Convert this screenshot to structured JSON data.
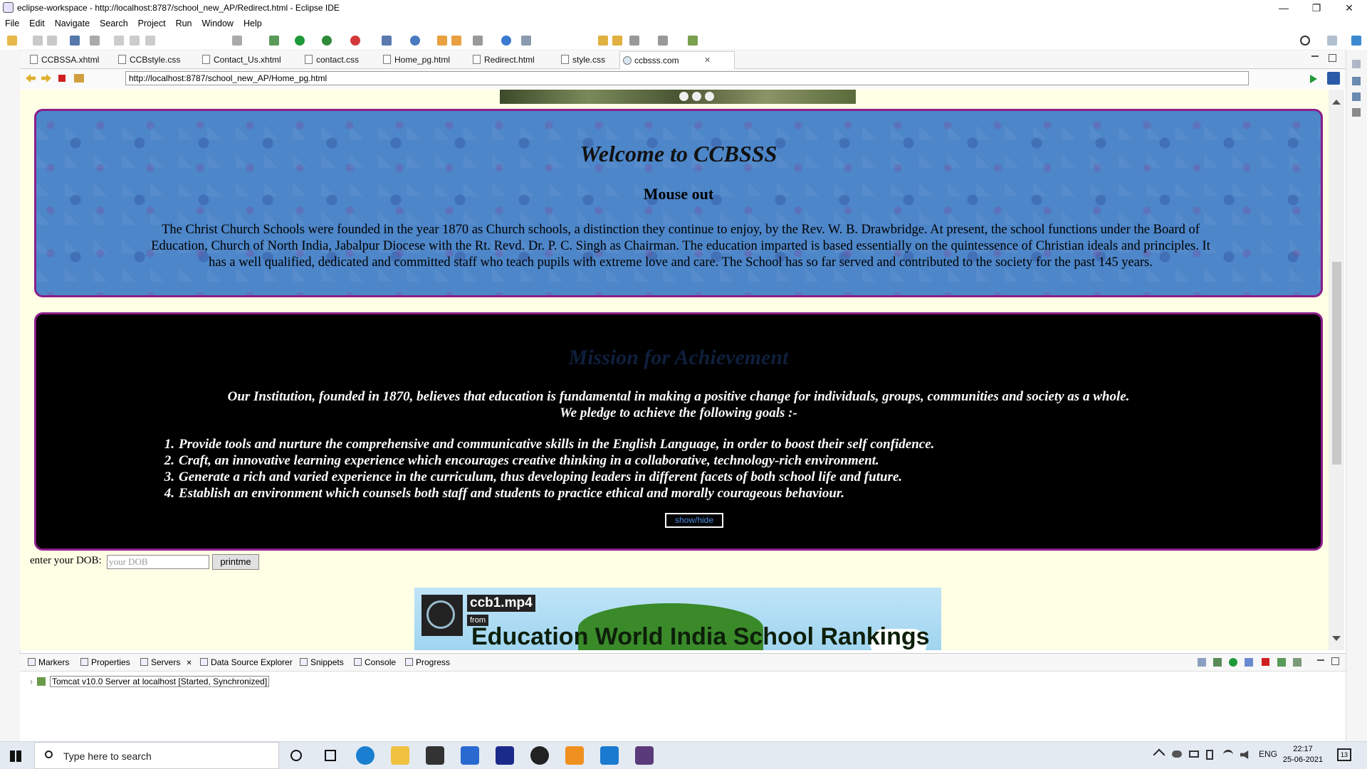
{
  "window": {
    "title": "eclipse-workspace - http://localhost:8787/school_new_AP/Redirect.html - Eclipse IDE",
    "minimize": "—",
    "maximize": "❐",
    "close": "✕"
  },
  "menu": [
    "File",
    "Edit",
    "Navigate",
    "Search",
    "Project",
    "Run",
    "Window",
    "Help"
  ],
  "editor_tabs": [
    {
      "label": "CCBSSA.xhtml"
    },
    {
      "label": "CCBstyle.css"
    },
    {
      "label": "Contact_Us.xhtml"
    },
    {
      "label": "contact.css"
    },
    {
      "label": "Home_pg.html"
    },
    {
      "label": "Redirect.html"
    },
    {
      "label": "style.css"
    },
    {
      "label": "ccbsss.com",
      "active": true
    }
  ],
  "close_icon": "✕",
  "browser": {
    "url": "http://localhost:8787/school_new_AP/Home_pg.html"
  },
  "page": {
    "welcome": {
      "title": "Welcome to CCBSSS",
      "subtitle": "Mouse out",
      "body": "The Christ Church Schools were founded in the year 1870 as Church schools, a distinction they continue to enjoy, by the Rev. W. B. Drawbridge. At present, the school functions under the Board of Education, Church of North India, Jabalpur Diocese with the Rt. Revd. Dr. P. C. Singh as Chairman. The education imparted is based essentially on the quintessence of Christian ideals and principles. It has a well qualified, dedicated and committed staff who teach pupils with extreme love and care. The School has so far served and contributed to the society for the past 145 years."
    },
    "mission": {
      "title": "Mission for Achievement",
      "intro_line1": "Our Institution, founded in 1870, believes that education is fundamental in making a positive change for individuals, groups, communities and society as a whole.",
      "intro_line2": "We pledge to achieve the following goals :-",
      "goals": [
        {
          "num": "1.",
          "text": "Provide tools and nurture the comprehensive and communicative skills in the English Language, in order to boost their self confidence."
        },
        {
          "num": "2.",
          "text": "Craft, an innovative learning experience which encourages creative thinking in a collaborative, technology-rich environment."
        },
        {
          "num": "3.",
          "text": "Generate a rich and varied experience in the curriculum, thus developing leaders in different facets of both school life and future."
        },
        {
          "num": "4.",
          "text": "Establish an environment which counsels both staff and students to practice ethical and morally courageous behaviour."
        }
      ],
      "button": "show/hide"
    },
    "dob": {
      "label": "enter your DOB:",
      "placeholder": "your DOB",
      "button": "printme"
    },
    "video": {
      "title": "ccb1.mp4",
      "from": "from",
      "headline": "Education World India School Rankings"
    }
  },
  "bottom_tabs": [
    "Markers",
    "Properties",
    "Servers",
    "Data Source Explorer",
    "Snippets",
    "Console",
    "Progress"
  ],
  "server": {
    "label": "Tomcat v10.0 Server at localhost  [Started, Synchronized]"
  },
  "taskbar": {
    "search_placeholder": "Type here to search",
    "language": "ENG",
    "time": "22:17",
    "date": "25-06-2021",
    "notification_count": "13"
  },
  "colors": {
    "page_bg": "#ffffe6",
    "welcome_bg": "#4d86c9",
    "border_accent": "#8a1f8a",
    "mission_bg": "#000000",
    "mission_title": "#0f1f3c",
    "link_blue": "#4f8ce0"
  }
}
